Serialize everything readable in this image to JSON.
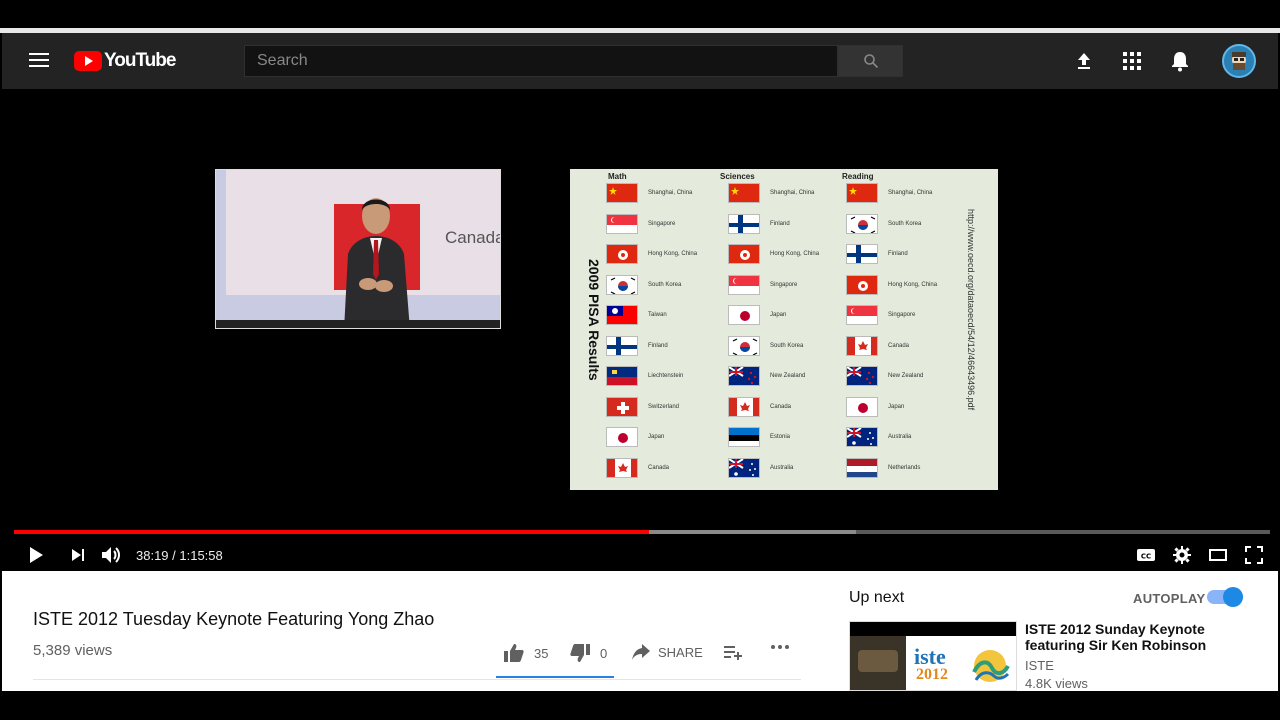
{
  "header": {
    "logo_text": "YouTube",
    "search_placeholder": "Search"
  },
  "player": {
    "slide": {
      "title": "2009 PISA Results",
      "url": "http://www.oecd.org/dataoecd/54/12/46643496.pdf",
      "columns": [
        {
          "heading": "Math",
          "countries": [
            "Shanghai, China",
            "Singapore",
            "Hong Kong, China",
            "South Korea",
            "Taiwan",
            "Finland",
            "Liechtenstein",
            "Switzerland",
            "Japan",
            "Canada"
          ]
        },
        {
          "heading": "Sciences",
          "countries": [
            "Shanghai, China",
            "Finland",
            "Hong Kong, China",
            "Singapore",
            "Japan",
            "South Korea",
            "New Zealand",
            "Canada",
            "Estonia",
            "Australia"
          ]
        },
        {
          "heading": "Reading",
          "countries": [
            "Shanghai, China",
            "South Korea",
            "Finland",
            "Hong Kong, China",
            "Singapore",
            "Canada",
            "New Zealand",
            "Japan",
            "Australia",
            "Netherlands"
          ]
        }
      ],
      "stage_text": "Canada"
    },
    "progress": {
      "played_fraction": 0.5055,
      "buffered_fraction": 0.67
    },
    "time_display": "38:19 / 1:15:58"
  },
  "video": {
    "title": "ISTE 2012 Tuesday Keynote Featuring Yong Zhao",
    "views": "5,389 views",
    "likes": "35",
    "dislikes": "0",
    "share_label": "SHARE"
  },
  "sidebar": {
    "up_next_label": "Up next",
    "autoplay_label": "AUTOPLAY",
    "autoplay_on": true,
    "recommendation": {
      "title": "ISTE 2012 Sunday Keynote featuring Sir Ken Robinson",
      "channel": "ISTE",
      "views": "4.8K views",
      "thumb_text_1": "iste",
      "thumb_text_2": "2012"
    }
  },
  "colors": {
    "accent_red": "#ff0000",
    "masthead": "#232323",
    "toggle_blue": "#1e88e5"
  }
}
